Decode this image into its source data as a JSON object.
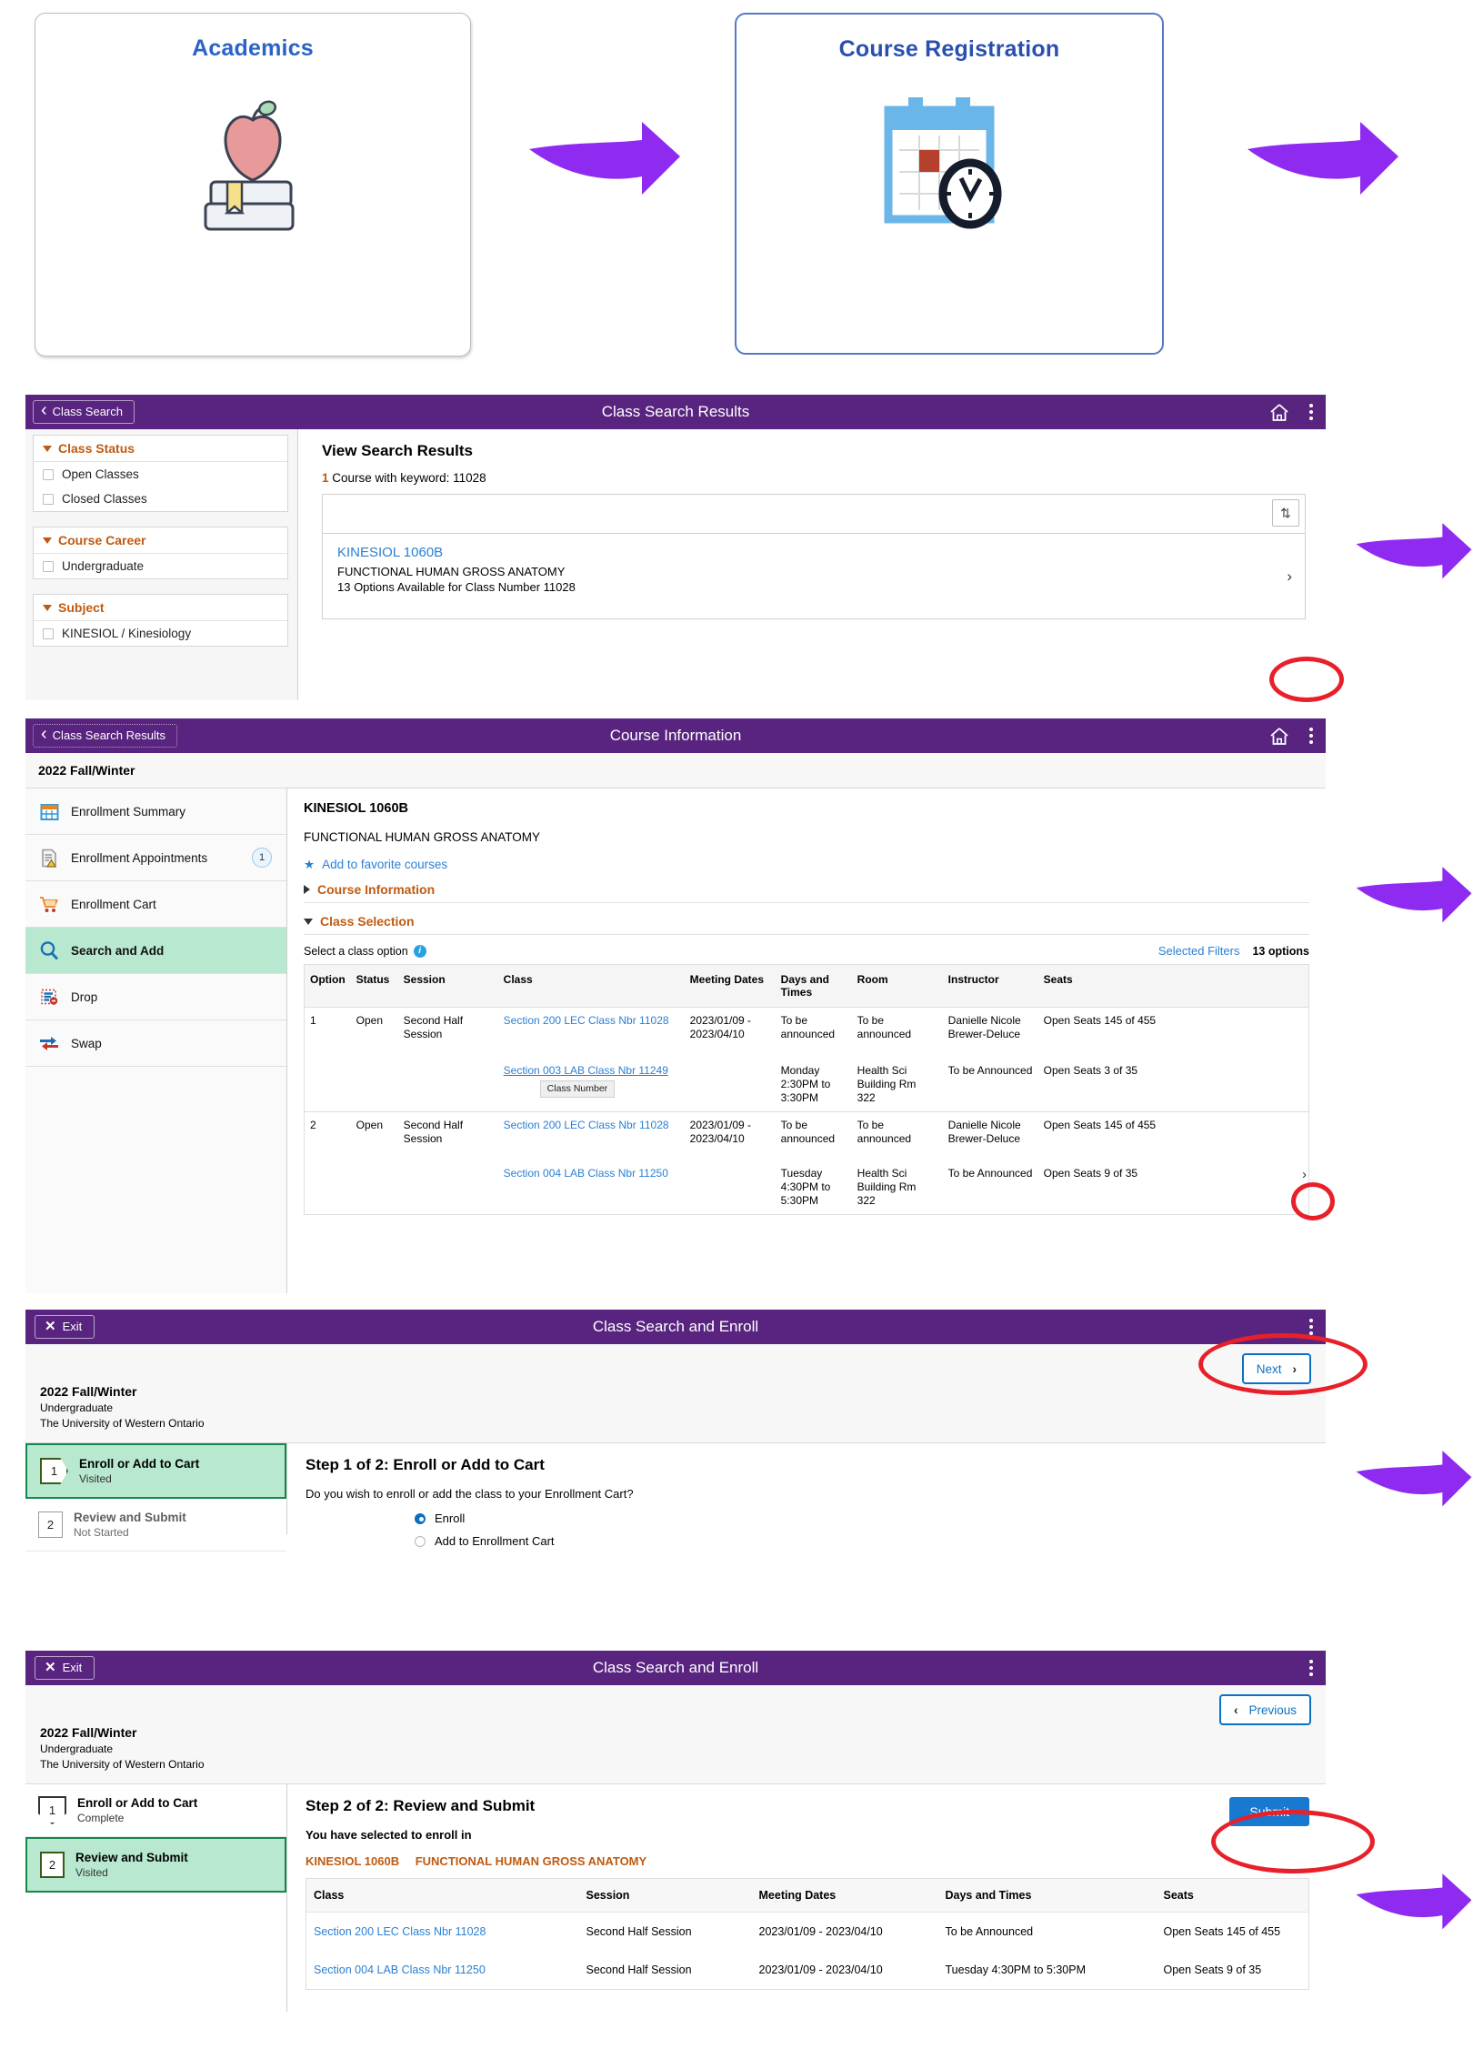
{
  "tiles": [
    {
      "title": "Academics",
      "icon": "apple-books-icon"
    },
    {
      "title": "Course Registration",
      "icon": "calendar-clock-icon"
    }
  ],
  "panel_class_search_results": {
    "header": {
      "back_label": "Class Search",
      "title": "Class Search Results",
      "home_icon": "home-icon",
      "menu_icon": "kebab-menu-icon"
    },
    "facets": [
      {
        "title": "Class Status",
        "items": [
          "Open Classes",
          "Closed Classes"
        ]
      },
      {
        "title": "Course Career",
        "items": [
          "Undergraduate"
        ]
      },
      {
        "title": "Subject",
        "items": [
          "KINESIOL / Kinesiology"
        ]
      }
    ],
    "results_title": "View Search Results",
    "count_number": "1",
    "count_text": "Course with keyword: 11028",
    "sort_icon": "sort-updown-icon",
    "result": {
      "course_code": "KINESIOL 1060B",
      "course_name": "FUNCTIONAL HUMAN GROSS ANATOMY",
      "options_text": "13 Options Available for Class Number 11028",
      "chevron": "›"
    }
  },
  "panel_course_information": {
    "header": {
      "back_label": "Class Search Results",
      "title": "Course Information",
      "home_icon": "home-icon",
      "menu_icon": "kebab-menu-icon"
    },
    "term": "2022 Fall/Winter",
    "nav": [
      {
        "label": "Enrollment Summary",
        "icon": "calendar-icon",
        "badge": ""
      },
      {
        "label": "Enrollment Appointments",
        "icon": "document-warning-icon",
        "badge": "1"
      },
      {
        "label": "Enrollment Cart",
        "icon": "shopping-cart-icon",
        "badge": ""
      },
      {
        "label": "Search and Add",
        "icon": "magnifier-icon",
        "badge": ""
      },
      {
        "label": "Drop",
        "icon": "drop-list-icon",
        "badge": ""
      },
      {
        "label": "Swap",
        "icon": "swap-arrows-icon",
        "badge": ""
      }
    ],
    "course_code": "KINESIOL 1060B",
    "course_name": "FUNCTIONAL HUMAN GROSS ANATOMY",
    "favorite_link": "Add to favorite courses",
    "section_course_info": "Course Information",
    "section_class_selection": "Class Selection",
    "select_hint": "Select a class option",
    "selected_filters": "Selected Filters",
    "options_count": "13 options",
    "tooltip": "Class Number",
    "table": {
      "columns": [
        "Option",
        "Status",
        "Session",
        "Class",
        "Meeting Dates",
        "Days and Times",
        "Room",
        "Instructor",
        "Seats"
      ],
      "rows": [
        {
          "option": "1",
          "status": "Open",
          "session": "Second Half Session",
          "lines": [
            {
              "class": "Section 200 LEC Class Nbr 11028",
              "dates": "2023/01/09 - 2023/04/10",
              "days": "To be announced",
              "room": "To be announced",
              "instructor": "Danielle Nicole Brewer-Deluce",
              "seats": "Open Seats 145 of 455"
            },
            {
              "class": "Section 003 LAB Class Nbr 11249",
              "dates": "",
              "days": "Monday 2:30PM to 3:30PM",
              "room": "Health Sci Building Rm 322",
              "instructor": "To be Announced",
              "seats": "Open Seats 3 of 35"
            }
          ]
        },
        {
          "option": "2",
          "status": "Open",
          "session": "Second Half Session",
          "lines": [
            {
              "class": "Section 200 LEC Class Nbr 11028",
              "dates": "2023/01/09 - 2023/04/10",
              "days": "To be announced",
              "room": "To be announced",
              "instructor": "Danielle Nicole Brewer-Deluce",
              "seats": "Open Seats 145 of 455"
            },
            {
              "class": "Section 004 LAB Class Nbr 11250",
              "dates": "",
              "days": "Tuesday 4:30PM to 5:30PM",
              "room": "Health Sci Building Rm 322",
              "instructor": "To be Announced",
              "seats": "Open Seats 9 of 35"
            }
          ]
        }
      ]
    }
  },
  "panel_enroll_step1": {
    "header": {
      "exit_label": "Exit",
      "title": "Class Search and Enroll",
      "menu_icon": "kebab-menu-icon"
    },
    "next_label": "Next",
    "term": "2022 Fall/Winter",
    "career": "Undergraduate",
    "institution": "The University of Western Ontario",
    "steps": [
      {
        "num": "1",
        "label": "Enroll or Add to Cart",
        "state": "Visited"
      },
      {
        "num": "2",
        "label": "Review and Submit",
        "state": "Not Started"
      }
    ],
    "step_title": "Step 1 of 2: Enroll or Add to Cart",
    "question": "Do you wish to enroll or add the class to your Enrollment Cart?",
    "options": [
      {
        "label": "Enroll",
        "selected": true
      },
      {
        "label": "Add to Enrollment Cart",
        "selected": false
      }
    ]
  },
  "panel_enroll_step2": {
    "header": {
      "exit_label": "Exit",
      "title": "Class Search and Enroll",
      "menu_icon": "kebab-menu-icon"
    },
    "previous_label": "Previous",
    "submit_label": "Submit",
    "term": "2022 Fall/Winter",
    "career": "Undergraduate",
    "institution": "The University of Western Ontario",
    "steps": [
      {
        "num": "1",
        "label": "Enroll or Add to Cart",
        "state": "Complete"
      },
      {
        "num": "2",
        "label": "Review and Submit",
        "state": "Visited"
      }
    ],
    "step_title": "Step 2 of 2: Review and Submit",
    "selected_line": "You have selected to enroll in",
    "course_code": "KINESIOL 1060B",
    "course_name": "FUNCTIONAL HUMAN GROSS ANATOMY",
    "table": {
      "columns": [
        "Class",
        "Session",
        "Meeting Dates",
        "Days and Times",
        "Seats"
      ],
      "rows": [
        [
          "Section 200 LEC Class Nbr 11028",
          "Second Half Session",
          "2023/01/09 - 2023/04/10",
          "To be Announced",
          "Open Seats 145 of 455"
        ],
        [
          "Section 004 LAB Class Nbr 11250",
          "Second Half Session",
          "2023/01/09 - 2023/04/10",
          "Tuesday   4:30PM to 5:30PM",
          "Open Seats 9 of 35"
        ]
      ]
    }
  },
  "colors": {
    "purple": "#58247f",
    "accent_orange": "#c05a10",
    "link_blue": "#2a7fd4",
    "arrow_purple": "#8f2bf0",
    "annotation_red": "#e8202a",
    "step_green": "#b8e8cf"
  }
}
